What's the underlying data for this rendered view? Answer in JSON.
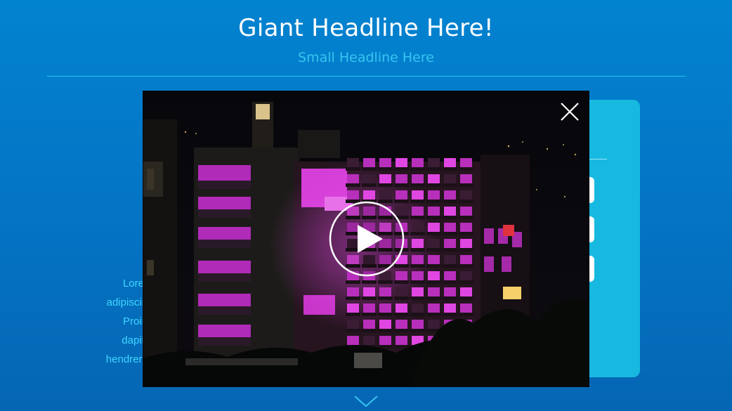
{
  "hero": {
    "headline": "Giant Headline Here!",
    "subheadline": "Small Headline Here"
  },
  "background_text": {
    "lines": [
      "Lorer",
      "adipiscin",
      "Proin",
      "dapib",
      "hendrerit"
    ]
  },
  "video_modal": {
    "close_icon": "close-icon",
    "play_icon": "play-icon",
    "scene": "night-building-magenta-lights"
  },
  "scroll_indicator": {
    "icon": "chevron-down-icon"
  },
  "colors": {
    "background": "#0478c8",
    "headline": "#ffffff",
    "subheadline": "#36c6f0",
    "accent": "#18b9e0",
    "body_text": "#3fd6ff",
    "window_light": "#d43ad8"
  }
}
